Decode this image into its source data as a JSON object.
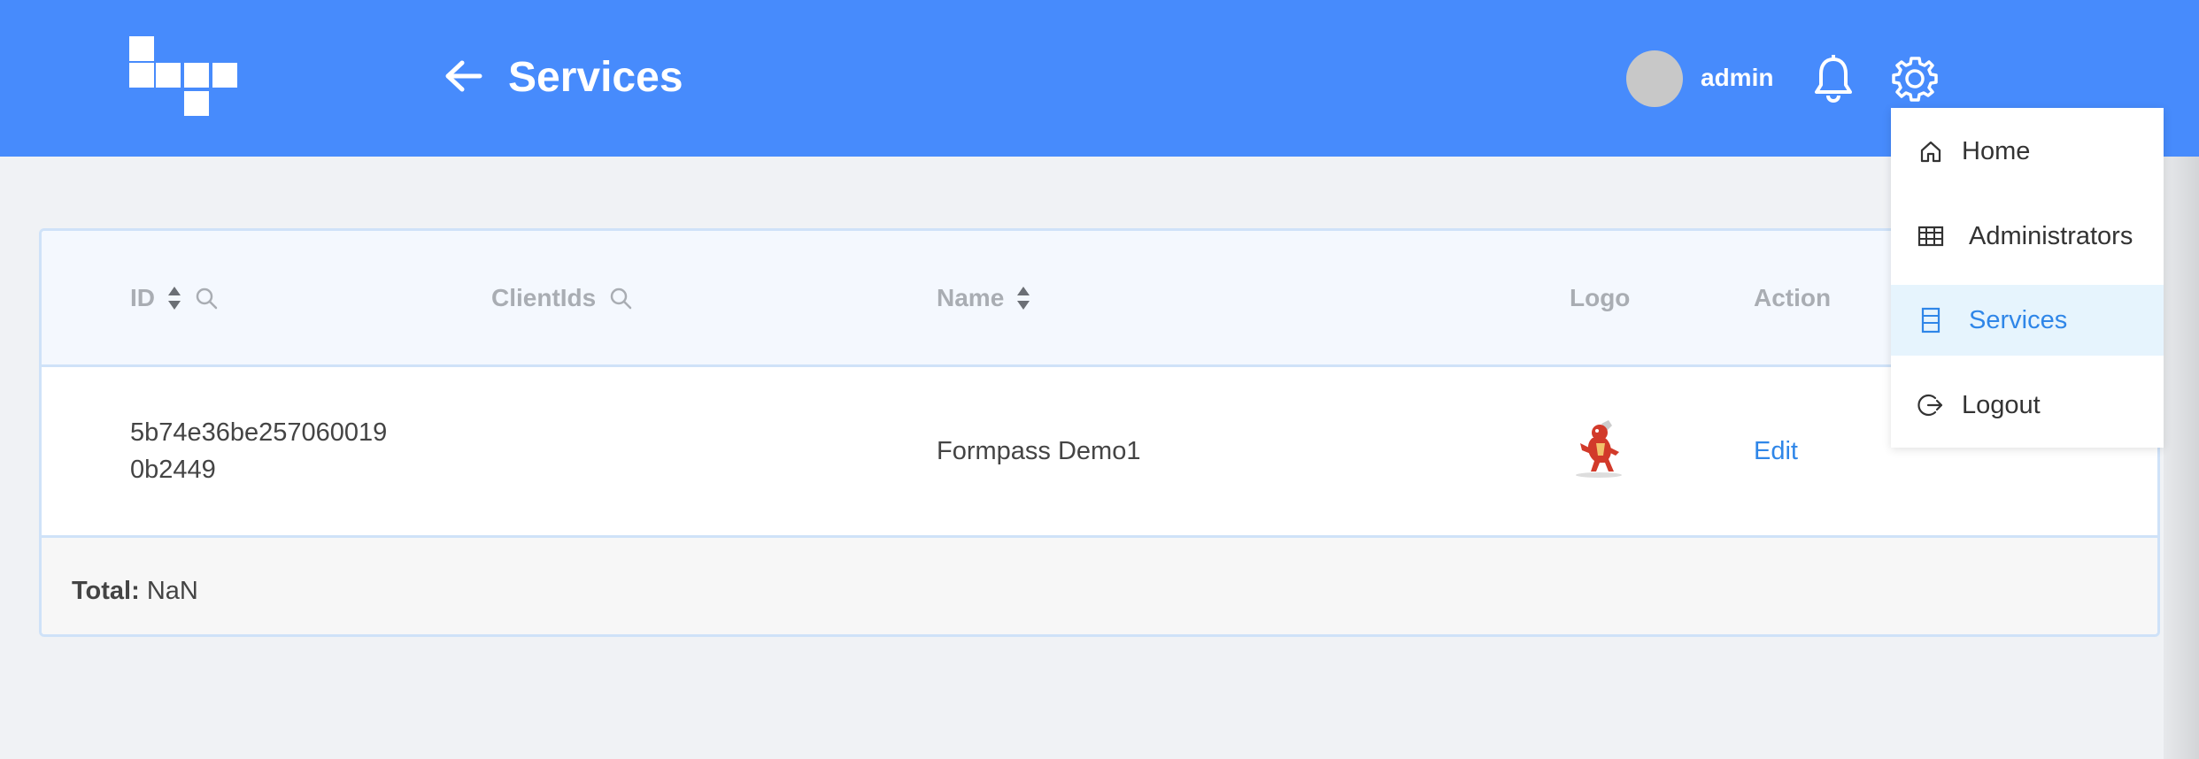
{
  "header": {
    "title": "Services",
    "username": "admin",
    "bg_color": "#478bfc"
  },
  "table": {
    "columns": {
      "id": "ID",
      "client_ids": "ClientIds",
      "name": "Name",
      "logo": "Logo",
      "action": "Action"
    },
    "rows": [
      {
        "id_line1": "5b74e36be257060019",
        "id_line2": "0b2449",
        "client_ids": "",
        "name": "Formpass Demo1",
        "logo": "dragon-mascot-image",
        "action": "Edit"
      }
    ],
    "footer": {
      "total_label": "Total:",
      "total_value": "NaN"
    }
  },
  "menu": {
    "items": [
      {
        "label": "Home",
        "icon": "home-icon"
      },
      {
        "label": "Administrators",
        "icon": "table-icon"
      },
      {
        "label": "Services",
        "icon": "server-icon",
        "active": true
      },
      {
        "label": "Logout",
        "icon": "logout-icon"
      }
    ],
    "active_color": "#2f86e8"
  }
}
